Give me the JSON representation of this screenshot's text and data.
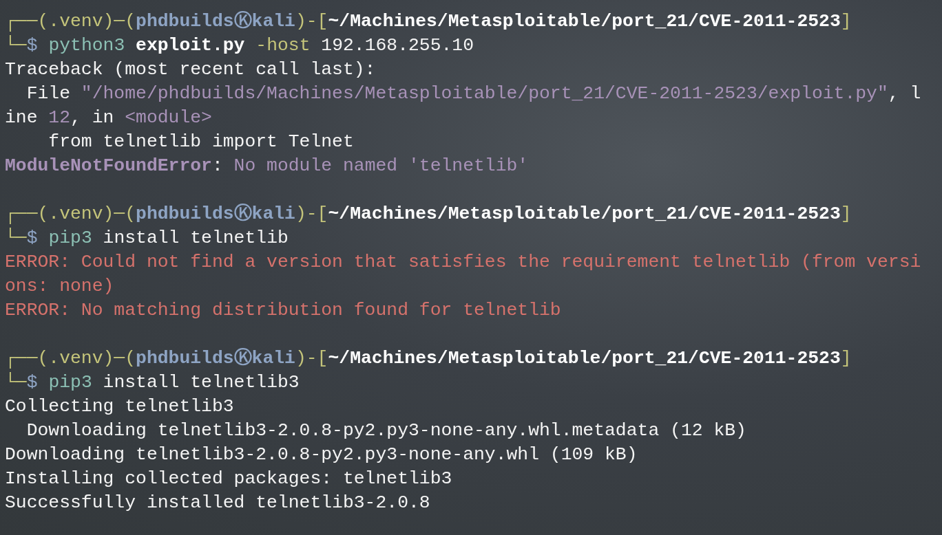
{
  "blocks": [
    {
      "lines": [
        {
          "segments": [
            {
              "kind": "frame",
              "text": "┌──(.venv)─("
            },
            {
              "kind": "user",
              "text": "phdbuildsⓀkali"
            },
            {
              "kind": "frame",
              "text": ")-["
            },
            {
              "kind": "path",
              "text": "~/Machines/Metasploitable/port_21/CVE-2011-2523"
            },
            {
              "kind": "frame",
              "text": "]"
            }
          ]
        },
        {
          "segments": [
            {
              "kind": "frame",
              "text": "└─"
            },
            {
              "kind": "dollar",
              "text": "$ "
            },
            {
              "kind": "command",
              "text": "python3"
            },
            {
              "kind": "arg",
              "text": " exploit.py"
            },
            {
              "kind": "option",
              "text": " -host"
            },
            {
              "kind": "plain",
              "text": " 192.168.255.10"
            }
          ]
        },
        {
          "segments": [
            {
              "kind": "plain",
              "text": "Traceback (most recent call last):"
            }
          ]
        },
        {
          "segments": [
            {
              "kind": "plain",
              "text": "  File "
            },
            {
              "kind": "string",
              "text": "\"/home/phdbuilds/Machines/Metasploitable/port_21/CVE-2011-2523/exploit.py\""
            },
            {
              "kind": "plain",
              "text": ", l"
            }
          ]
        },
        {
          "segments": [
            {
              "kind": "plain",
              "text": "ine "
            },
            {
              "kind": "string",
              "text": "12"
            },
            {
              "kind": "plain",
              "text": ", in "
            },
            {
              "kind": "string",
              "text": "<module>"
            }
          ]
        },
        {
          "segments": [
            {
              "kind": "plain",
              "text": "    from telnetlib import Telnet"
            }
          ]
        },
        {
          "segments": [
            {
              "kind": "errname",
              "text": "ModuleNotFoundError"
            },
            {
              "kind": "plain",
              "text": ": "
            },
            {
              "kind": "string",
              "text": "No module named 'telnetlib'"
            }
          ]
        }
      ]
    },
    {
      "lines": [
        {
          "segments": [
            {
              "kind": "frame",
              "text": "┌──(.venv)─("
            },
            {
              "kind": "user",
              "text": "phdbuildsⓀkali"
            },
            {
              "kind": "frame",
              "text": ")-["
            },
            {
              "kind": "path",
              "text": "~/Machines/Metasploitable/port_21/CVE-2011-2523"
            },
            {
              "kind": "frame",
              "text": "]"
            }
          ]
        },
        {
          "segments": [
            {
              "kind": "frame",
              "text": "└─"
            },
            {
              "kind": "dollar",
              "text": "$ "
            },
            {
              "kind": "command",
              "text": "pip3"
            },
            {
              "kind": "plain",
              "text": " install telnetlib"
            }
          ]
        },
        {
          "segments": [
            {
              "kind": "error",
              "text": "ERROR: Could not find a version that satisfies the requirement telnetlib (from versi"
            }
          ]
        },
        {
          "segments": [
            {
              "kind": "error",
              "text": "ons: none)"
            }
          ]
        },
        {
          "segments": [
            {
              "kind": "error",
              "text": "ERROR: No matching distribution found for telnetlib"
            }
          ]
        }
      ]
    },
    {
      "lines": [
        {
          "segments": [
            {
              "kind": "frame",
              "text": "┌──(.venv)─("
            },
            {
              "kind": "user",
              "text": "phdbuildsⓀkali"
            },
            {
              "kind": "frame",
              "text": ")-["
            },
            {
              "kind": "path",
              "text": "~/Machines/Metasploitable/port_21/CVE-2011-2523"
            },
            {
              "kind": "frame",
              "text": "]"
            }
          ]
        },
        {
          "segments": [
            {
              "kind": "frame",
              "text": "└─"
            },
            {
              "kind": "dollar",
              "text": "$ "
            },
            {
              "kind": "command",
              "text": "pip3"
            },
            {
              "kind": "plain",
              "text": " install telnetlib3"
            }
          ]
        },
        {
          "segments": [
            {
              "kind": "plain",
              "text": "Collecting telnetlib3"
            }
          ]
        },
        {
          "segments": [
            {
              "kind": "plain",
              "text": "  Downloading telnetlib3-2.0.8-py2.py3-none-any.whl.metadata (12 kB)"
            }
          ]
        },
        {
          "segments": [
            {
              "kind": "plain",
              "text": "Downloading telnetlib3-2.0.8-py2.py3-none-any.whl (109 kB)"
            }
          ]
        },
        {
          "segments": [
            {
              "kind": "plain",
              "text": "Installing collected packages: telnetlib3"
            }
          ]
        },
        {
          "segments": [
            {
              "kind": "plain",
              "text": "Successfully installed telnetlib3-2.0.8"
            }
          ]
        }
      ]
    }
  ]
}
